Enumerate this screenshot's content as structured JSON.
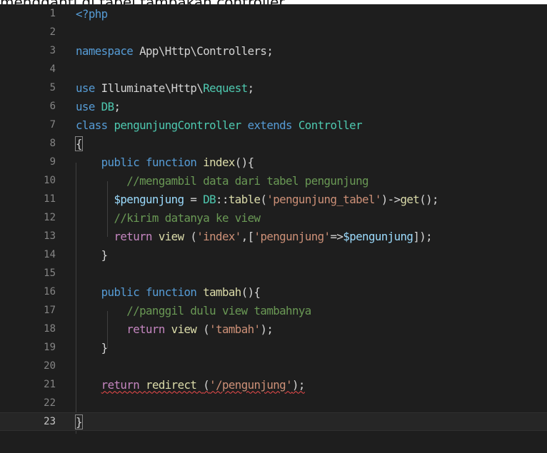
{
  "top_text": "mengganti di tabel tampakan controller",
  "editor": {
    "active_line": 23,
    "lines": [
      {
        "n": "1",
        "tokens": [
          {
            "t": "<?php",
            "c": "t-tag"
          }
        ]
      },
      {
        "n": "2",
        "tokens": []
      },
      {
        "n": "3",
        "tokens": [
          {
            "t": "namespace ",
            "c": "t-kw"
          },
          {
            "t": "App\\Http\\Controllers",
            "c": "t-ns"
          },
          {
            "t": ";",
            "c": "t-punc"
          }
        ]
      },
      {
        "n": "4",
        "tokens": []
      },
      {
        "n": "5",
        "tokens": [
          {
            "t": "use ",
            "c": "t-kw"
          },
          {
            "t": "Illuminate\\Http\\",
            "c": "t-ns"
          },
          {
            "t": "Request",
            "c": "t-cls"
          },
          {
            "t": ";",
            "c": "t-punc"
          }
        ]
      },
      {
        "n": "6",
        "tokens": [
          {
            "t": "use ",
            "c": "t-kw"
          },
          {
            "t": "DB",
            "c": "t-cls"
          },
          {
            "t": ";",
            "c": "t-punc"
          }
        ]
      },
      {
        "n": "7",
        "tokens": [
          {
            "t": "class ",
            "c": "t-kw"
          },
          {
            "t": "pengunjungController ",
            "c": "t-cls"
          },
          {
            "t": "extends ",
            "c": "t-kw"
          },
          {
            "t": "Controller",
            "c": "t-cls"
          }
        ]
      },
      {
        "n": "8",
        "tokens": [
          {
            "t": "{",
            "c": "t-punc bracket-box"
          }
        ]
      },
      {
        "n": "9",
        "tokens": [
          {
            "t": "    public ",
            "c": "t-kw"
          },
          {
            "t": "function ",
            "c": "t-kw"
          },
          {
            "t": "index",
            "c": "t-fn"
          },
          {
            "t": "(){",
            "c": "t-punc"
          }
        ]
      },
      {
        "n": "10",
        "tokens": [
          {
            "t": "        //mengambil data dari tabel pengunjung",
            "c": "t-cmt"
          }
        ]
      },
      {
        "n": "11",
        "tokens": [
          {
            "t": "      $pengunjung",
            "c": "t-var"
          },
          {
            "t": " = ",
            "c": "t-punc"
          },
          {
            "t": "DB",
            "c": "t-cls"
          },
          {
            "t": "::",
            "c": "t-punc"
          },
          {
            "t": "table",
            "c": "t-fn"
          },
          {
            "t": "(",
            "c": "t-punc"
          },
          {
            "t": "'pengunjung_tabel'",
            "c": "t-str"
          },
          {
            "t": ")->",
            "c": "t-punc"
          },
          {
            "t": "get",
            "c": "t-fn"
          },
          {
            "t": "();",
            "c": "t-punc"
          }
        ]
      },
      {
        "n": "12",
        "tokens": [
          {
            "t": "      //kirim datanya ke view",
            "c": "t-cmt"
          }
        ]
      },
      {
        "n": "13",
        "tokens": [
          {
            "t": "      return ",
            "c": "t-ctl"
          },
          {
            "t": "view ",
            "c": "t-fn"
          },
          {
            "t": "(",
            "c": "t-punc"
          },
          {
            "t": "'index'",
            "c": "t-str"
          },
          {
            "t": ",[",
            "c": "t-punc"
          },
          {
            "t": "'pengunjung'",
            "c": "t-str"
          },
          {
            "t": "=>",
            "c": "t-punc"
          },
          {
            "t": "$pengunjung",
            "c": "t-var"
          },
          {
            "t": "]);",
            "c": "t-punc"
          }
        ]
      },
      {
        "n": "14",
        "tokens": [
          {
            "t": "    }",
            "c": "t-punc"
          }
        ]
      },
      {
        "n": "15",
        "tokens": []
      },
      {
        "n": "16",
        "tokens": [
          {
            "t": "    public ",
            "c": "t-kw"
          },
          {
            "t": "function ",
            "c": "t-kw"
          },
          {
            "t": "tambah",
            "c": "t-fn"
          },
          {
            "t": "(){",
            "c": "t-punc"
          }
        ]
      },
      {
        "n": "17",
        "tokens": [
          {
            "t": "        //panggil dulu view tambahnya",
            "c": "t-cmt"
          }
        ]
      },
      {
        "n": "18",
        "tokens": [
          {
            "t": "        return ",
            "c": "t-ctl"
          },
          {
            "t": "view ",
            "c": "t-fn"
          },
          {
            "t": "(",
            "c": "t-punc"
          },
          {
            "t": "'tambah'",
            "c": "t-str"
          },
          {
            "t": ");",
            "c": "t-punc"
          }
        ]
      },
      {
        "n": "19",
        "tokens": [
          {
            "t": "    }",
            "c": "t-punc"
          }
        ]
      },
      {
        "n": "20",
        "tokens": []
      },
      {
        "n": "21",
        "tokens": [
          {
            "t": "    ",
            "c": "t-punc"
          },
          {
            "t": "return ",
            "c": "t-ctl squiggle"
          },
          {
            "t": "redirect ",
            "c": "t-fn squiggle"
          },
          {
            "t": "(",
            "c": "t-punc squiggle"
          },
          {
            "t": "'/pengunjung'",
            "c": "t-str squiggle"
          },
          {
            "t": ");",
            "c": "t-punc squiggle"
          }
        ]
      },
      {
        "n": "22",
        "tokens": []
      },
      {
        "n": "23",
        "tokens": [
          {
            "t": "}",
            "c": "t-punc bracket-box"
          }
        ]
      }
    ]
  }
}
